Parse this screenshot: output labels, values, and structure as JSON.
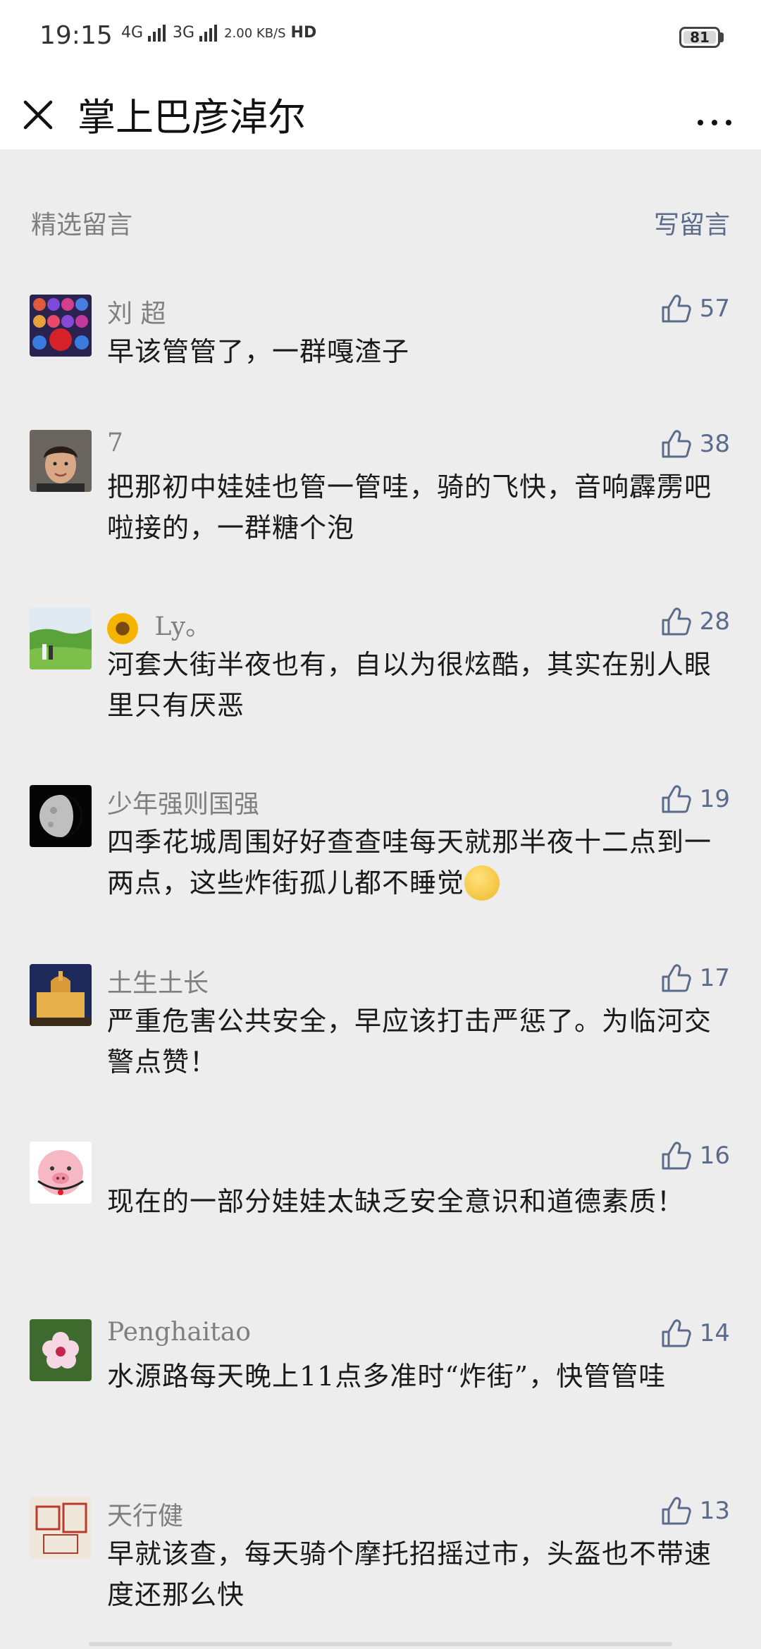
{
  "status_bar": {
    "time": "19:15",
    "network_1": "4G",
    "network_2": "3G",
    "speed": "2.00 KB/S",
    "hd": "HD",
    "battery": "81"
  },
  "nav": {
    "title": "掌上巴彦淖尔"
  },
  "section": {
    "title": "精选留言",
    "write_label": "写留言"
  },
  "comments": [
    {
      "name": "刘 超",
      "likes": "57",
      "text": "早该管管了，一群嘎渣子",
      "avatar": "flowers-avatar"
    },
    {
      "name": "7",
      "likes": "38",
      "text": "把那初中娃娃也管一管哇，骑的飞快，音响霹雳吧啦接的，一群糖个泡",
      "avatar": "boy-avatar"
    },
    {
      "name": "Ly。",
      "likes": "28",
      "text": "河套大街半夜也有，自以为很炫酷，其实在别人眼里只有厌恶",
      "avatar": "meadow-avatar"
    },
    {
      "name": "少年强则国强",
      "likes": "19",
      "text": "四季花城周围好好查查哇每天就那半夜十二点到一两点，这些炸街孤儿都不睡觉",
      "avatar": "moon-avatar"
    },
    {
      "name": "土生土长",
      "likes": "17",
      "text": "严重危害公共安全，早应该打击严惩了。为临河交警点赞！",
      "avatar": "building-avatar"
    },
    {
      "name": "",
      "likes": "16",
      "text": "现在的一部分娃娃太缺乏安全意识和道德素质！",
      "avatar": "pig-avatar"
    },
    {
      "name": "Penghaitao",
      "likes": "14",
      "text": "水源路每天晚上11点多准时“炸街”，快管管哇",
      "avatar": "flower-avatar"
    },
    {
      "name": "天行健",
      "likes": "13",
      "text": "早就该查，每天骑个摩托招摇过市，头盔也不带速度还那么快",
      "avatar": "seal-avatar"
    }
  ],
  "colors": {
    "background": "#ededed",
    "link": "#5b6b8c",
    "name": "#7f7f7f"
  }
}
